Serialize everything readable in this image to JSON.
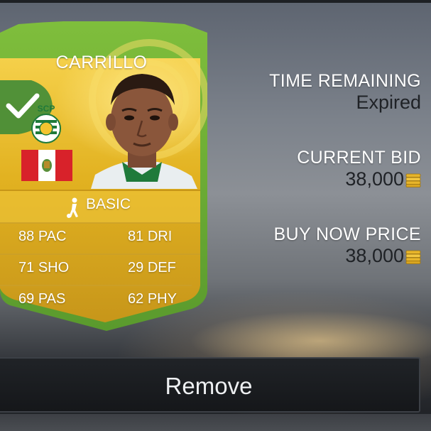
{
  "card": {
    "name": "CARRILLO",
    "card_type": "BASIC",
    "selected": true,
    "stats": [
      {
        "value": "88",
        "label": "PAC"
      },
      {
        "value": "81",
        "label": "DRI"
      },
      {
        "value": "71",
        "label": "SHO"
      },
      {
        "value": "29",
        "label": "DEF"
      },
      {
        "value": "69",
        "label": "PAS"
      },
      {
        "value": "62",
        "label": "PHY"
      }
    ],
    "club_badge_text": "SCP",
    "nation": "peru-flag",
    "colors": {
      "gold": "#e6b823",
      "green_border": "#6fb03a",
      "check_green": "#3f8b37"
    }
  },
  "auction": {
    "time_remaining_label": "TIME REMAINING",
    "time_remaining_value": "Expired",
    "current_bid_label": "CURRENT BID",
    "current_bid_value": "38,000",
    "buy_now_label": "BUY NOW PRICE",
    "buy_now_value": "38,000",
    "currency_icon": "coins-icon"
  },
  "actions": {
    "remove_label": "Remove"
  }
}
